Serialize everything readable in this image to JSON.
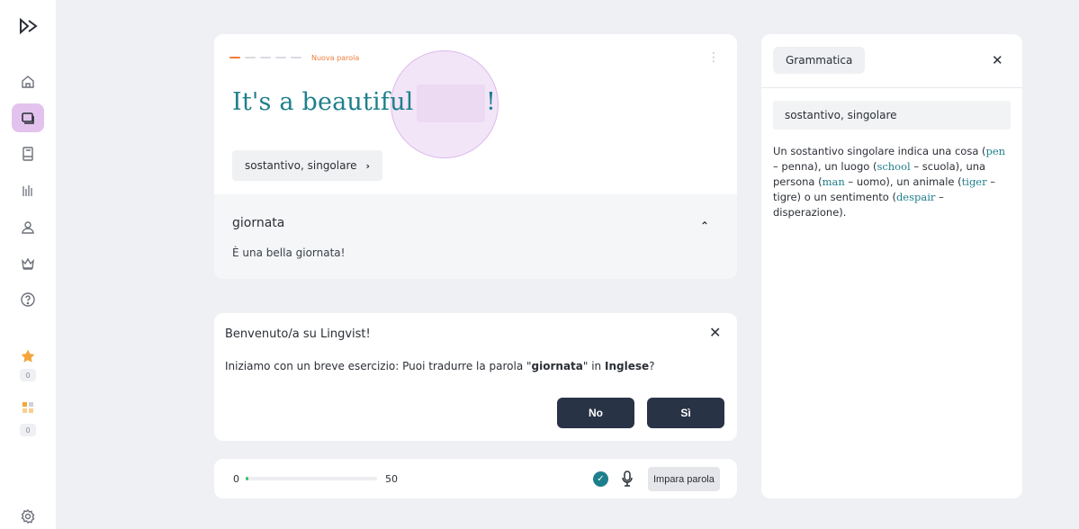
{
  "sidebar": {
    "logo": "lingvist-logo-icon",
    "items": [
      {
        "icon": "home-icon",
        "active": false
      },
      {
        "icon": "cards-icon",
        "active": true
      },
      {
        "icon": "book-icon",
        "active": false
      },
      {
        "icon": "stats-icon",
        "active": false
      },
      {
        "icon": "user-icon",
        "active": false
      },
      {
        "icon": "crown-icon",
        "active": false
      },
      {
        "icon": "help-icon",
        "active": false
      }
    ],
    "streak_count": "0",
    "words_count": "0",
    "settings_icon": "settings-icon"
  },
  "card": {
    "progress_label": "Nuova parola",
    "sentence_start": "It's a beautiful",
    "sentence_end": "!",
    "grammar_chip": "sostantivo, singolare",
    "answer_word": "giornata",
    "answer_translation": "È una bella giornata!"
  },
  "welcome": {
    "title": "Benvenuto/a su Lingvist!",
    "text_before": "Iniziamo con un breve esercizio: Puoi tradurre la parola \"",
    "text_word": "giornata",
    "text_middle": "\" in ",
    "text_language": "Inglese",
    "text_after": "?",
    "no_label": "No",
    "yes_label": "Sì"
  },
  "bottom_bar": {
    "current": "0",
    "target": "50",
    "progress_fraction": 0.02,
    "learn_label": "Impara parola"
  },
  "grammar_panel": {
    "tab_label": "Grammatica",
    "type_label": "sostantivo, singolare",
    "p1": "Un sostantivo singolare indica una cosa (",
    "ex1": "pen",
    "p2": " – penna), un luogo (",
    "ex2": "school",
    "p3": " – scuola), una persona (",
    "ex3": "man",
    "p4": " – uomo), un animale (",
    "ex4": "tiger",
    "p5": " – tigre) o un sentimento (",
    "ex5": "despair",
    "p6": " – disperazione)."
  },
  "colors": {
    "accent_teal": "#1e7f8c",
    "accent_orange": "#f07d3b",
    "active_nav": "#e3c3ee",
    "button_dark": "#283345"
  }
}
